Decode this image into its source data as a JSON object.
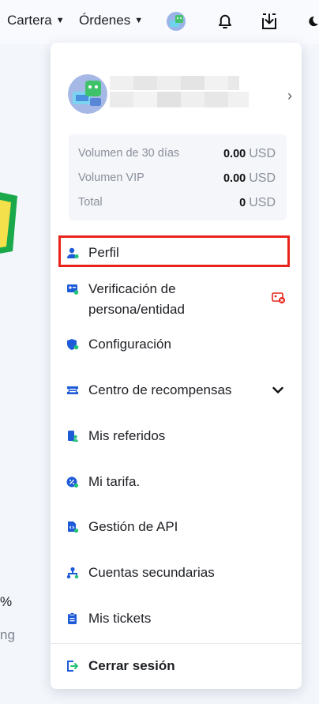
{
  "nav": {
    "wallet_label": "Cartera",
    "orders_label": "Órdenes",
    "caret": "▼"
  },
  "background": {
    "percent_text": "%",
    "partial_text": "ng"
  },
  "profile": {
    "chevron": "›"
  },
  "stats": [
    {
      "label": "Volumen de 30 días",
      "value": "0.00",
      "unit": "USD"
    },
    {
      "label": "Volumen VIP",
      "value": "0.00",
      "unit": "USD"
    },
    {
      "label": "Total",
      "value": "0",
      "unit": "USD"
    }
  ],
  "menu": {
    "profile": "Perfil",
    "verification_line1": "Verificación de",
    "verification_line2": "persona/entidad",
    "settings": "Configuración",
    "rewards": "Centro de recompensas",
    "referrals": "Mis referidos",
    "fee": "Mi tarifa.",
    "api": "Gestión de API",
    "subaccounts": "Cuentas secundarias",
    "tickets": "Mis tickets",
    "logout": "Cerrar sesión"
  },
  "colors": {
    "accent": "#1e5bd8",
    "highlight": "#e8231b",
    "warning": "#e8231b"
  }
}
